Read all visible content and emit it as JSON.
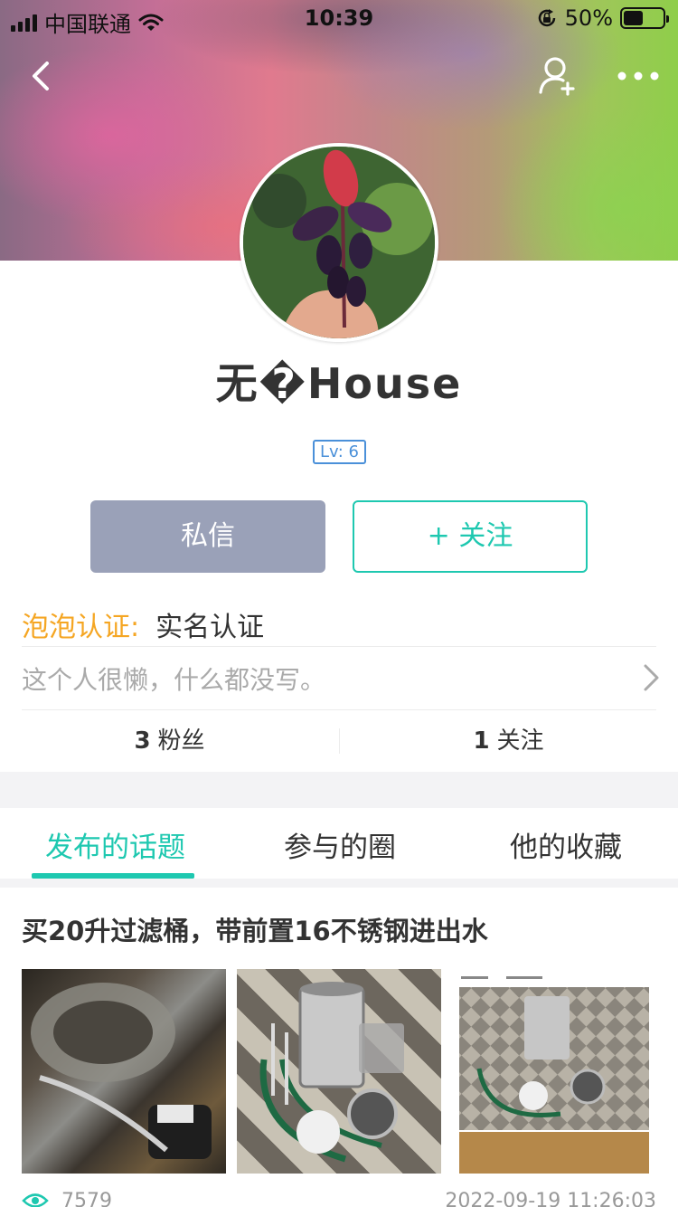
{
  "status_bar": {
    "carrier": "中国联通",
    "time": "10:39",
    "battery": "50%",
    "battery_level": 0.5
  },
  "nav": {
    "back_icon": "chevron-left-icon",
    "add_friend_icon": "person-add-icon",
    "more_icon": "more-dots-icon"
  },
  "profile": {
    "name": "无�House",
    "level": "Lv: 6"
  },
  "actions": {
    "message_label": "私信",
    "follow_label": "+ 关注"
  },
  "certification": {
    "label": "泡泡认证:",
    "value": "实名认证"
  },
  "bio": {
    "text": "这个人很懒，什么都没写。"
  },
  "stats": {
    "fans_count": "3",
    "fans_label": "粉丝",
    "following_count": "1",
    "following_label": "关注"
  },
  "tabs": [
    {
      "label": "发布的话题",
      "active": true
    },
    {
      "label": "参与的圈",
      "active": false
    },
    {
      "label": "他的收藏",
      "active": false
    }
  ],
  "post": {
    "title": "买20升过滤桶，带前置16不锈钢进出水",
    "views": "7579",
    "date": "2022-09-19 11:26:03"
  },
  "colors": {
    "accent": "#1ec8b0",
    "message_button": "#9aa1b8",
    "cert_label": "#f5a623",
    "level_badge": "#4a90d9"
  }
}
